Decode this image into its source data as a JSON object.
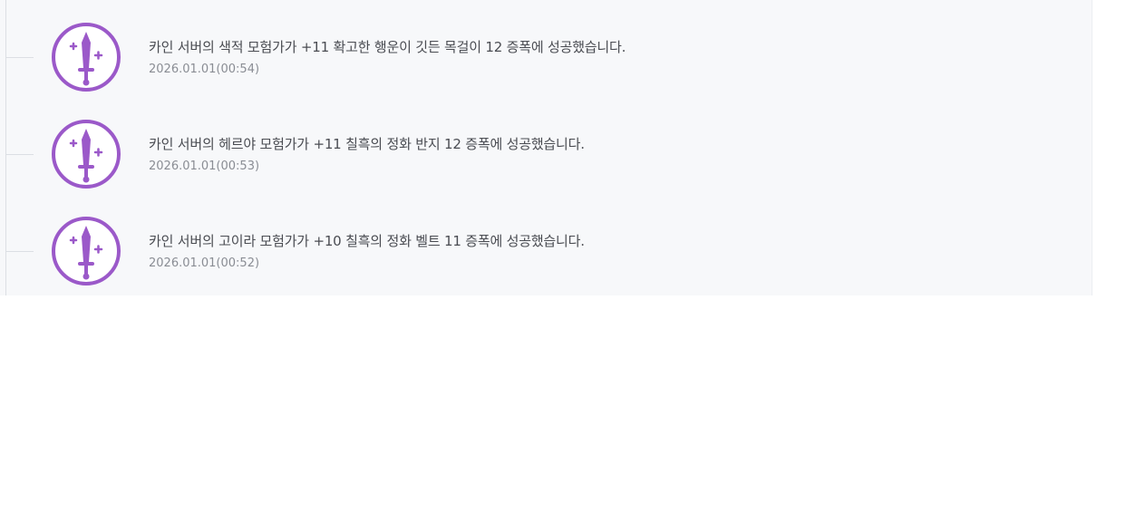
{
  "feed": {
    "accent_color": "#9b59c9",
    "badge_icon": "sword-icon",
    "items": [
      {
        "message": "카인 서버의 색적 모험가가 +11 확고한 행운이 깃든 목걸이 12 증폭에 성공했습니다.",
        "timestamp": "2026.01.01(00:54)"
      },
      {
        "message": "카인 서버의 헤르야 모험가가 +11 칠흑의 정화 반지 12 증폭에 성공했습니다.",
        "timestamp": "2026.01.01(00:53)"
      },
      {
        "message": "카인 서버의 고이라 모험가가 +10 칠흑의 정화 벨트 11 증폭에 성공했습니다.",
        "timestamp": "2026.01.01(00:52)"
      }
    ]
  }
}
